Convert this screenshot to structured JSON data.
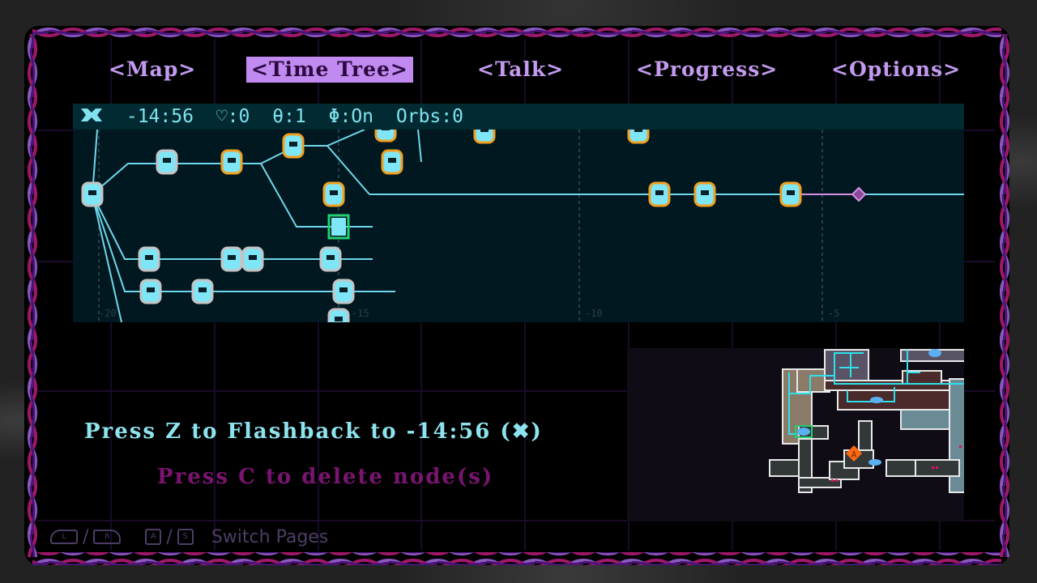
{
  "tabs": [
    {
      "label": "<Map>",
      "active": false
    },
    {
      "label": "<Time Tree>",
      "active": true
    },
    {
      "label": "<Talk>",
      "active": false
    },
    {
      "label": "<Progress>",
      "active": false
    },
    {
      "label": "<Options>",
      "active": false
    }
  ],
  "status": {
    "icon": "flashback-icon",
    "time": "-14:56",
    "hearts": "♡:0",
    "keys": "θ:1",
    "phi": "Φ:On",
    "orbs": "Orbs:0"
  },
  "tree": {
    "axis_labels": [
      "-20",
      "-15",
      "-10",
      "-5"
    ],
    "colors": {
      "line": "#6fd8ec",
      "future_line": "#d690e8",
      "node_fill": "#7ee6f6",
      "node_border": "#c4c4c4",
      "node_accent": "#f0a020",
      "selected": "#22d070",
      "end_marker": "#8a4a9a"
    }
  },
  "messages": {
    "flashback": "Press Z to Flashback to -14:56 (✖)",
    "delete": "Press C to delete node(s)"
  },
  "hint": {
    "l_label": "L",
    "r_label": "R",
    "a_label": "A",
    "s_label": "S",
    "slash": "/",
    "text": "Switch Pages"
  },
  "minimap": {
    "marker_label": "A",
    "colors": {
      "path": "#2ee0ea",
      "marker": "#ff6a10",
      "current_room": "#22d070",
      "save": "#5ab0f0",
      "item": "#e0106a"
    }
  }
}
